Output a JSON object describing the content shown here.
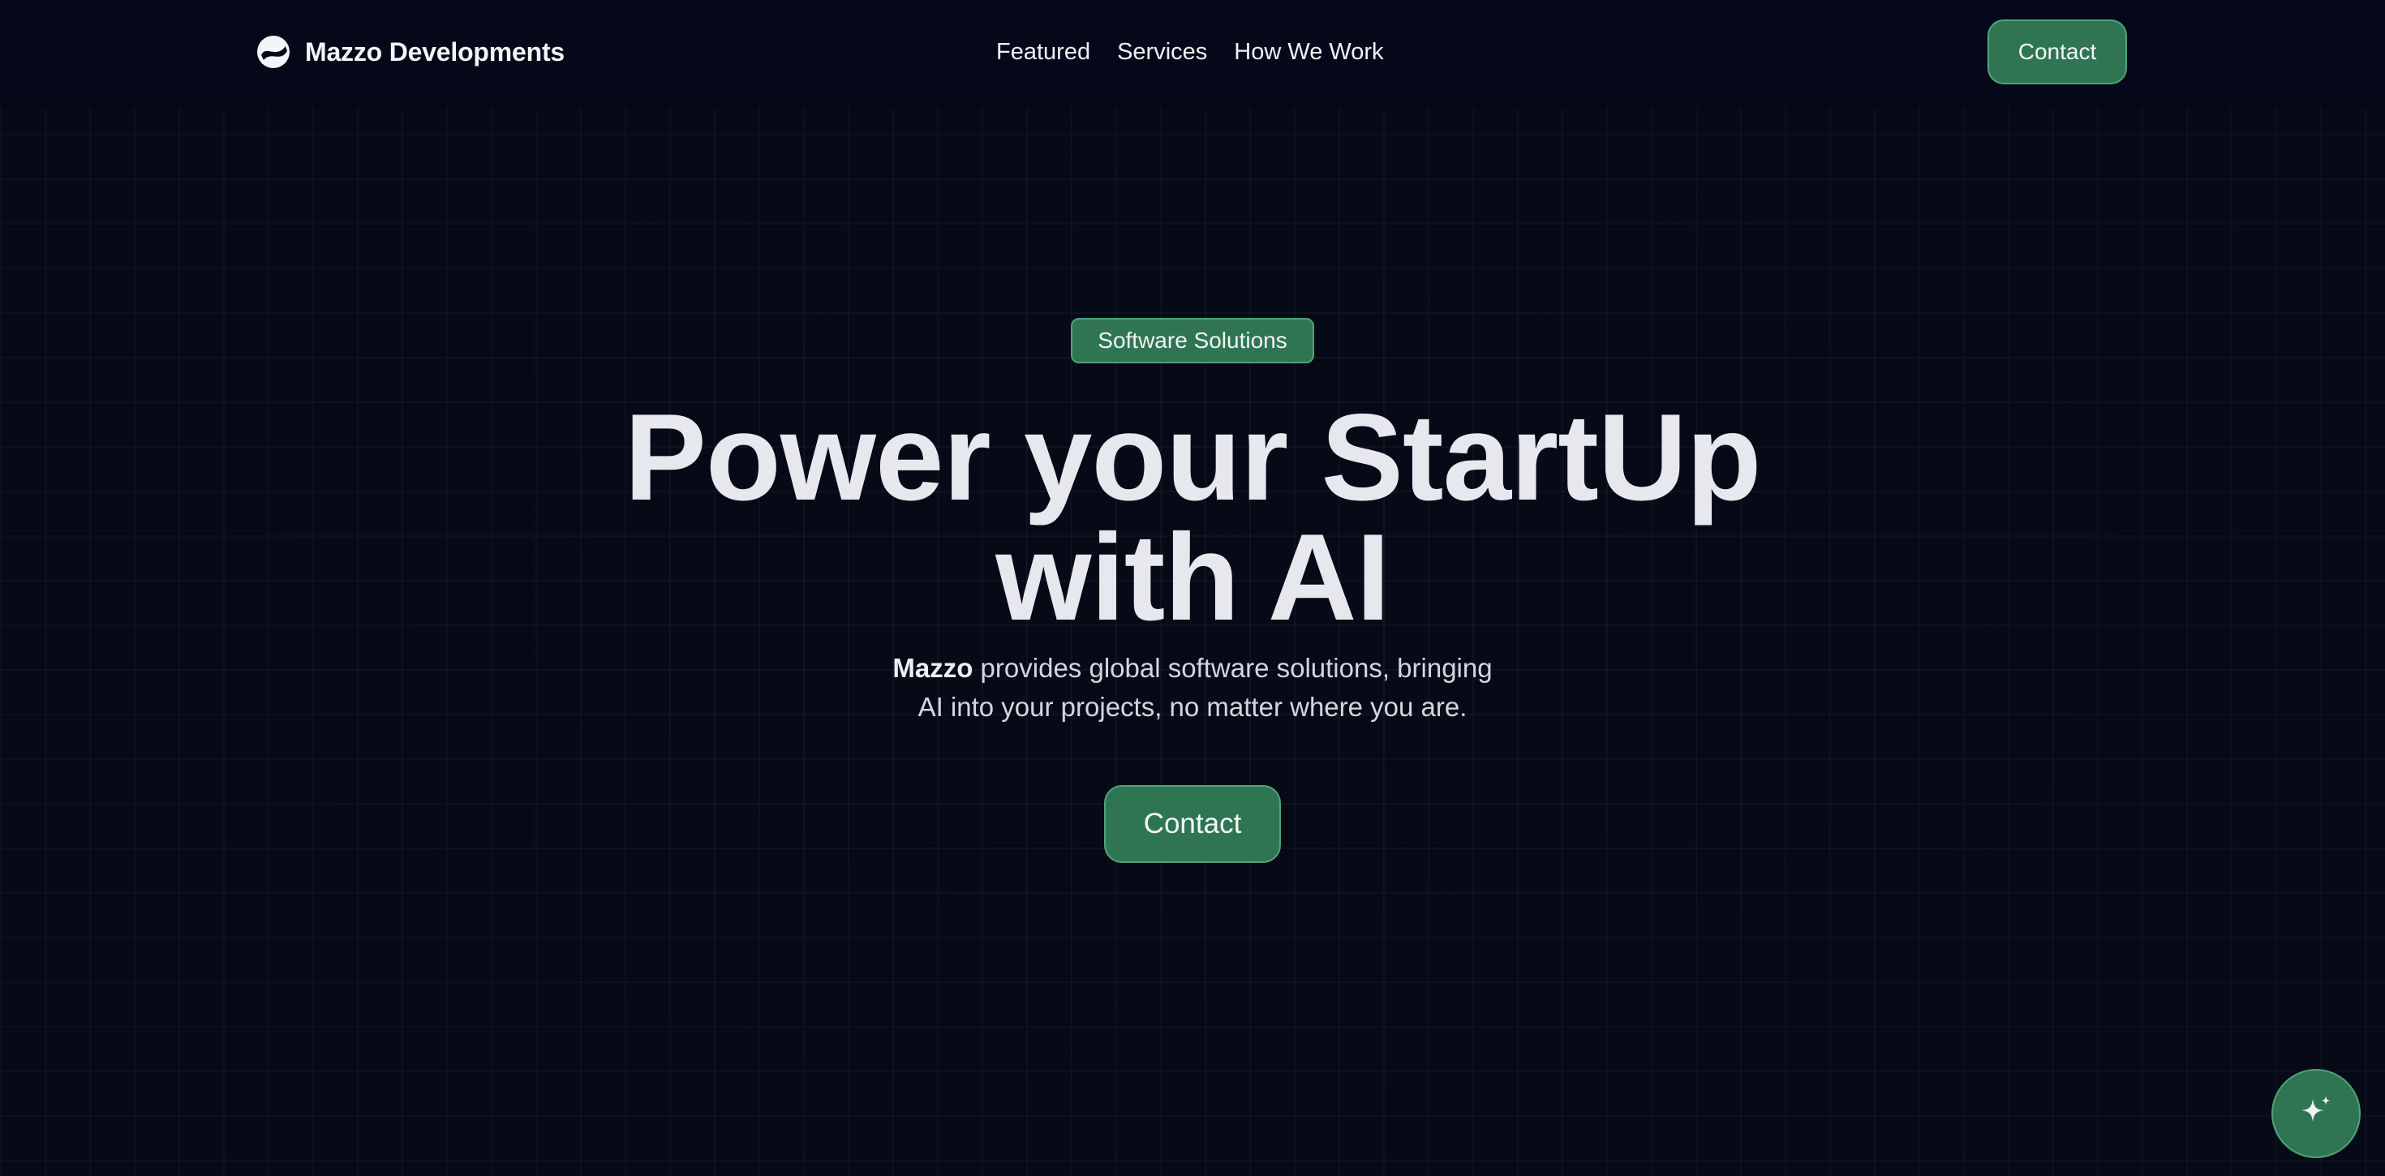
{
  "brand": {
    "name": "Mazzo Developments",
    "icon": "mazzo-logo-icon"
  },
  "nav": {
    "links": [
      {
        "label": "Featured"
      },
      {
        "label": "Services"
      },
      {
        "label": "How We Work"
      }
    ],
    "contact_label": "Contact"
  },
  "hero": {
    "badge": "Software Solutions",
    "headline_line1": "Power your StartUp",
    "headline_line2": "with AI",
    "tagline_brand": "Mazzo",
    "tagline_rest_line1": " provides global software solutions, bringing",
    "tagline_line2": "AI into your projects, no matter where you are.",
    "contact_label": "Contact"
  },
  "fab": {
    "icon": "sparkles-icon"
  },
  "colors": {
    "background": "#060a17",
    "nav_background": "#040819",
    "accent": "#2f7554",
    "accent_border": "#4ea477",
    "headline": "#e6e8ee"
  }
}
